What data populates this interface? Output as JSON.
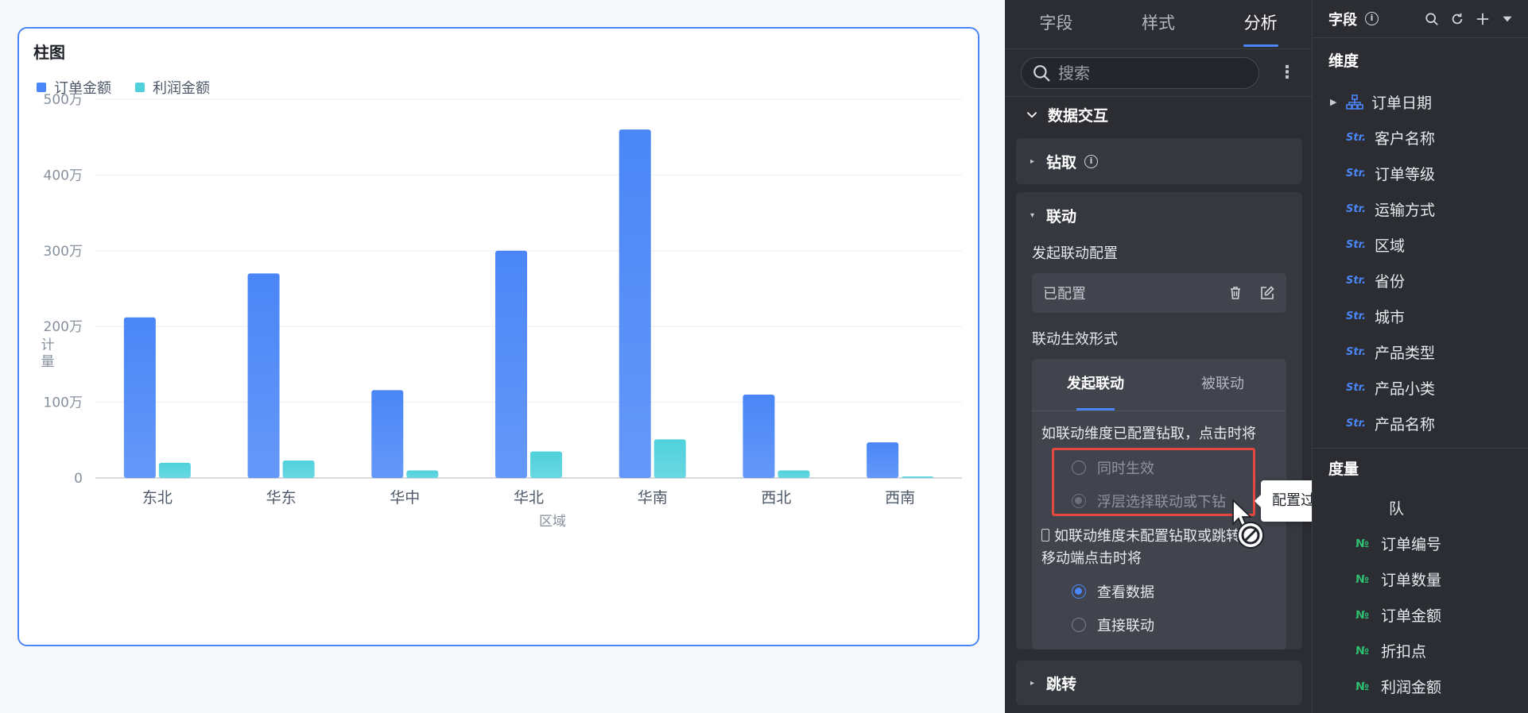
{
  "chart_card": {
    "title": "柱图",
    "legend": [
      {
        "label": "订单金额",
        "color": "#4a86f7"
      },
      {
        "label": "利润金额",
        "color": "#4fd1dc"
      }
    ]
  },
  "chart_data": {
    "type": "bar",
    "title": "柱图",
    "xlabel": "区域",
    "ylabel": "计量",
    "categories": [
      "东北",
      "华东",
      "华中",
      "华北",
      "华南",
      "西北",
      "西南"
    ],
    "series": [
      {
        "name": "订单金额",
        "color": "#4a86f7",
        "values": [
          2120000,
          2700000,
          1160000,
          3000000,
          4600000,
          1100000,
          470000
        ]
      },
      {
        "name": "利润金额",
        "color": "#4fd1dc",
        "values": [
          200000,
          230000,
          100000,
          350000,
          510000,
          100000,
          20000
        ]
      }
    ],
    "ylim": [
      0,
      5000000
    ],
    "yticks": [
      {
        "value": 0,
        "label": "0"
      },
      {
        "value": 1000000,
        "label": "100万"
      },
      {
        "value": 2000000,
        "label": "200万"
      },
      {
        "value": 3000000,
        "label": "300万"
      },
      {
        "value": 4000000,
        "label": "400万"
      },
      {
        "value": 5000000,
        "label": "500万"
      }
    ],
    "grid": true,
    "legend_position": "top-left"
  },
  "panel": {
    "tabs": [
      "字段",
      "样式",
      "分析"
    ],
    "active_tab": "分析",
    "search_placeholder": "搜索",
    "more_icon": "⋮",
    "section_title": "数据交互",
    "drill_title": "钻取",
    "link_title": "联动",
    "initiate_config_label": "发起联动配置",
    "configured_text": "已配置",
    "effect_form_label": "联动生效形式",
    "inner_tabs": [
      "发起联动",
      "被联动"
    ],
    "drill_hint": "如联动维度已配置钻取，点击时将",
    "option_simultaneous": "同时生效",
    "option_float": "浮层选择联动或下钻",
    "tooltip_text": "配置过钻取生效",
    "mobile_note_line1": "如联动维度未配置钻取或跳转",
    "mobile_note_line2": "移动端点击时将",
    "option_view_data": "查看数据",
    "option_direct_link": "直接联动",
    "jump_title": "跳转"
  },
  "fields_panel": {
    "title": "字段",
    "dimension_title": "维度",
    "dimensions": [
      "订单日期",
      "客户名称",
      "订单等级",
      "运输方式",
      "区域",
      "省份",
      "城市",
      "产品类型",
      "产品小类",
      "产品名称"
    ],
    "measure_title": "度量",
    "measure_first_partial": "队",
    "measures": [
      "订单编号",
      "订单数量",
      "订单金额",
      "折扣点",
      "利润金额"
    ],
    "str_tag": "Str.",
    "num_tag": "№"
  }
}
